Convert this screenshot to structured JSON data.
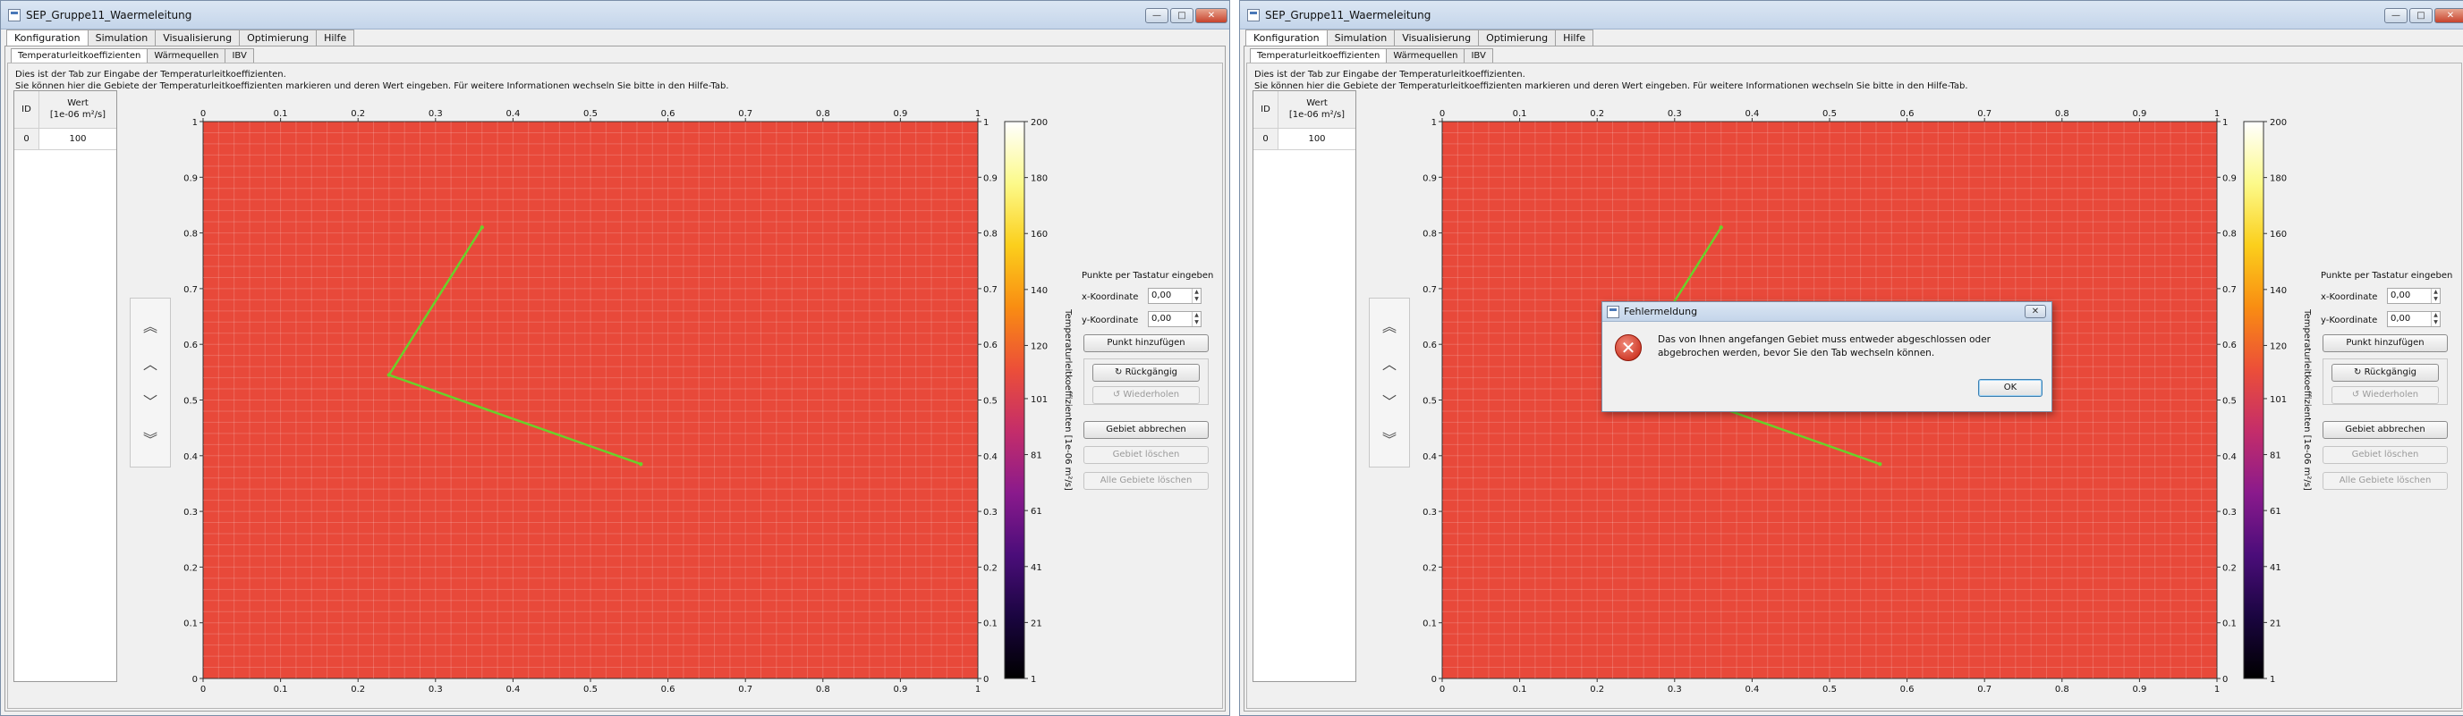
{
  "windows": [
    {
      "title": "SEP_Gruppe11_Waermeleitung",
      "window_buttons": {
        "minimize": "—",
        "maximize": "□",
        "close": "✕"
      },
      "tabs": [
        "Konfiguration",
        "Simulation",
        "Visualisierung",
        "Optimierung",
        "Hilfe"
      ],
      "active_tab": "Konfiguration",
      "subtabs": [
        "Temperaturleitkoeffizienten",
        "Wärmequellen",
        "IBV"
      ],
      "active_subtab": "Temperaturleitkoeffizienten",
      "description_line1": "Dies ist der Tab zur Eingabe der Temperaturleitkoeffizienten.",
      "description_line2": "Sie können hier die Gebiete der Temperaturleitkoeffizienten markieren und deren Wert eingeben. Für weitere Informationen wechseln Sie bitte in den Hilfe-Tab.",
      "table": {
        "header_id": "ID",
        "header_value_line1": "Wert",
        "header_value_line2": "[1e-06 m²/s]",
        "rows": [
          {
            "id": "0",
            "value": "100"
          }
        ]
      },
      "nav_icons": [
        "double-up-icon",
        "up-icon",
        "down-icon",
        "double-down-icon"
      ],
      "keyboard": {
        "title": "Punkte per Tastatur eingeben",
        "x_label": "x-Koordinate",
        "x_value": "0,00",
        "y_label": "y-Koordinate",
        "y_value": "0,00",
        "add_point": "Punkt hinzufügen",
        "undo": "Rückgängig",
        "redo": "Wiederholen",
        "cancel_area": "Gebiet abbrechen",
        "delete_area": "Gebiet löschen",
        "delete_all": "Alle Gebiete löschen"
      },
      "colorbar_label": "Temperaturleitkoeffizienten [1e-06 m²/s]",
      "dialog": null
    },
    {
      "title": "SEP_Gruppe11_Waermeleitung",
      "window_buttons": {
        "minimize": "—",
        "maximize": "□",
        "close": "✕"
      },
      "tabs": [
        "Konfiguration",
        "Simulation",
        "Visualisierung",
        "Optimierung",
        "Hilfe"
      ],
      "active_tab": "Konfiguration",
      "subtabs": [
        "Temperaturleitkoeffizienten",
        "Wärmequellen",
        "IBV"
      ],
      "active_subtab": "Temperaturleitkoeffizienten",
      "description_line1": "Dies ist der Tab zur Eingabe der Temperaturleitkoeffizienten.",
      "description_line2": "Sie können hier die Gebiete der Temperaturleitkoeffizienten markieren und deren Wert eingeben. Für weitere Informationen wechseln Sie bitte in den Hilfe-Tab.",
      "table": {
        "header_id": "ID",
        "header_value_line1": "Wert",
        "header_value_line2": "[1e-06 m²/s]",
        "rows": [
          {
            "id": "0",
            "value": "100"
          }
        ]
      },
      "nav_icons": [
        "double-up-icon",
        "up-icon",
        "down-icon",
        "double-down-icon"
      ],
      "keyboard": {
        "title": "Punkte per Tastatur eingeben",
        "x_label": "x-Koordinate",
        "x_value": "0,00",
        "y_label": "y-Koordinate",
        "y_value": "0,00",
        "add_point": "Punkt hinzufügen",
        "undo": "Rückgängig",
        "redo": "Wiederholen",
        "cancel_area": "Gebiet abbrechen",
        "delete_area": "Gebiet löschen",
        "delete_all": "Alle Gebiete löschen"
      },
      "colorbar_label": "Temperaturleitkoeffizienten [1e-06 m²/s]",
      "dialog": {
        "title": "Fehlermeldung",
        "message_line1": "Das von Ihnen angefangen Gebiet muss entweder abgeschlossen oder",
        "message_line2": "abgebrochen werden, bevor Sie den Tab wechseln können.",
        "ok": "OK",
        "close": "✕"
      }
    }
  ],
  "colors": {
    "field": "#e8493a",
    "polyline": "#6ad12a",
    "colormap": [
      "#000000",
      "#1a0540",
      "#4b0d7a",
      "#8a1a8c",
      "#c42d6a",
      "#ec4f38",
      "#f98d12",
      "#fbcf1c",
      "#fcfa8a",
      "#ffffff"
    ]
  },
  "chart_data": {
    "type": "heatmap",
    "x_ticks": [
      "0",
      "0.1",
      "0.2",
      "0.3",
      "0.4",
      "0.5",
      "0.6",
      "0.7",
      "0.8",
      "0.9",
      "1"
    ],
    "y_ticks": [
      "0",
      "0.1",
      "0.2",
      "0.3",
      "0.4",
      "0.5",
      "0.6",
      "0.7",
      "0.8",
      "0.9",
      "1"
    ],
    "xlim": [
      0,
      1
    ],
    "ylim": [
      0,
      1
    ],
    "grid": true,
    "field_value": 100,
    "colorbar_ticks": [
      "1",
      "21",
      "41",
      "61",
      "81",
      "101",
      "120",
      "140",
      "160",
      "180",
      "200"
    ],
    "colorbar_range": [
      1,
      200
    ],
    "polyline": [
      {
        "x": 0.36,
        "y": 0.81
      },
      {
        "x": 0.24,
        "y": 0.545
      },
      {
        "x": 0.565,
        "y": 0.385
      }
    ]
  }
}
